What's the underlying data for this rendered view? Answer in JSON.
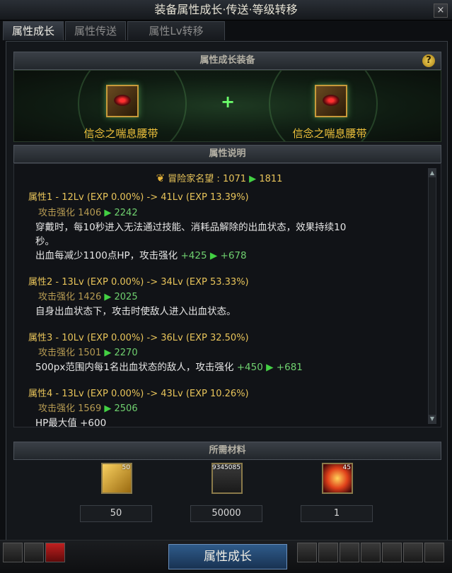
{
  "window": {
    "title": "装备属性成长·传送·等级转移",
    "close_label": "×"
  },
  "tabs": [
    {
      "label": "属性成长",
      "active": true
    },
    {
      "label": "属性传送",
      "active": false
    },
    {
      "label": "属性Lv转移",
      "active": false
    }
  ],
  "equip_section": {
    "header": "属性成长装备",
    "help_label": "?",
    "left_item_name": "信念之喘息腰带",
    "right_item_name": "信念之喘息腰带",
    "plus": "+"
  },
  "description_section": {
    "header": "属性说明",
    "renown": {
      "label": "冒险家名望 : 1071",
      "target": "1811"
    },
    "attributes": [
      {
        "title": "属性1 - 12Lv (EXP 0.00%) -> 41Lv (EXP 13.39%)",
        "stat": "攻击强化 1406",
        "stat_target": "2242",
        "lines": [
          {
            "text": "穿戴时，每10秒进入无法通过技能、消耗品解除的出血状态，效果持续10"
          },
          {
            "text": "秒。"
          },
          {
            "text": "出血每减少1100点HP，攻击强化",
            "value": "+425",
            "value_target": "+678"
          }
        ]
      },
      {
        "title": "属性2 - 13Lv (EXP 0.00%) -> 34Lv (EXP 53.33%)",
        "stat": "攻击强化 1426",
        "stat_target": "2025",
        "lines": [
          {
            "text": "自身出血状态下，攻击时使敌人进入出血状态。"
          }
        ]
      },
      {
        "title": "属性3 - 10Lv (EXP 0.00%) -> 36Lv (EXP 32.50%)",
        "stat": "攻击强化 1501",
        "stat_target": "2270",
        "lines": [
          {
            "text": "500px范围内每1名出血状态的敌人，攻击强化",
            "value": "+450",
            "value_target": "+681"
          }
        ]
      },
      {
        "title": "属性4 - 13Lv (EXP 0.00%) -> 43Lv (EXP 10.26%)",
        "stat": "攻击强化 1569",
        "stat_target": "2506",
        "lines": [
          {
            "text": "HP最大值 +600"
          }
        ]
      }
    ]
  },
  "materials_section": {
    "header": "所需材料",
    "items": [
      {
        "badge": "50",
        "count": "50",
        "icon": "gold-card-icon"
      },
      {
        "badge": "9345085",
        "count": "50000",
        "icon": "gold-bars-icon"
      },
      {
        "badge": "45",
        "count": "1",
        "icon": "fire-orb-icon"
      }
    ]
  },
  "action_button": {
    "label": "属性成长"
  },
  "colors": {
    "accent_gold": "#e8c45a",
    "positive_green": "#43d043",
    "button_blue": "#2f5b8a"
  }
}
